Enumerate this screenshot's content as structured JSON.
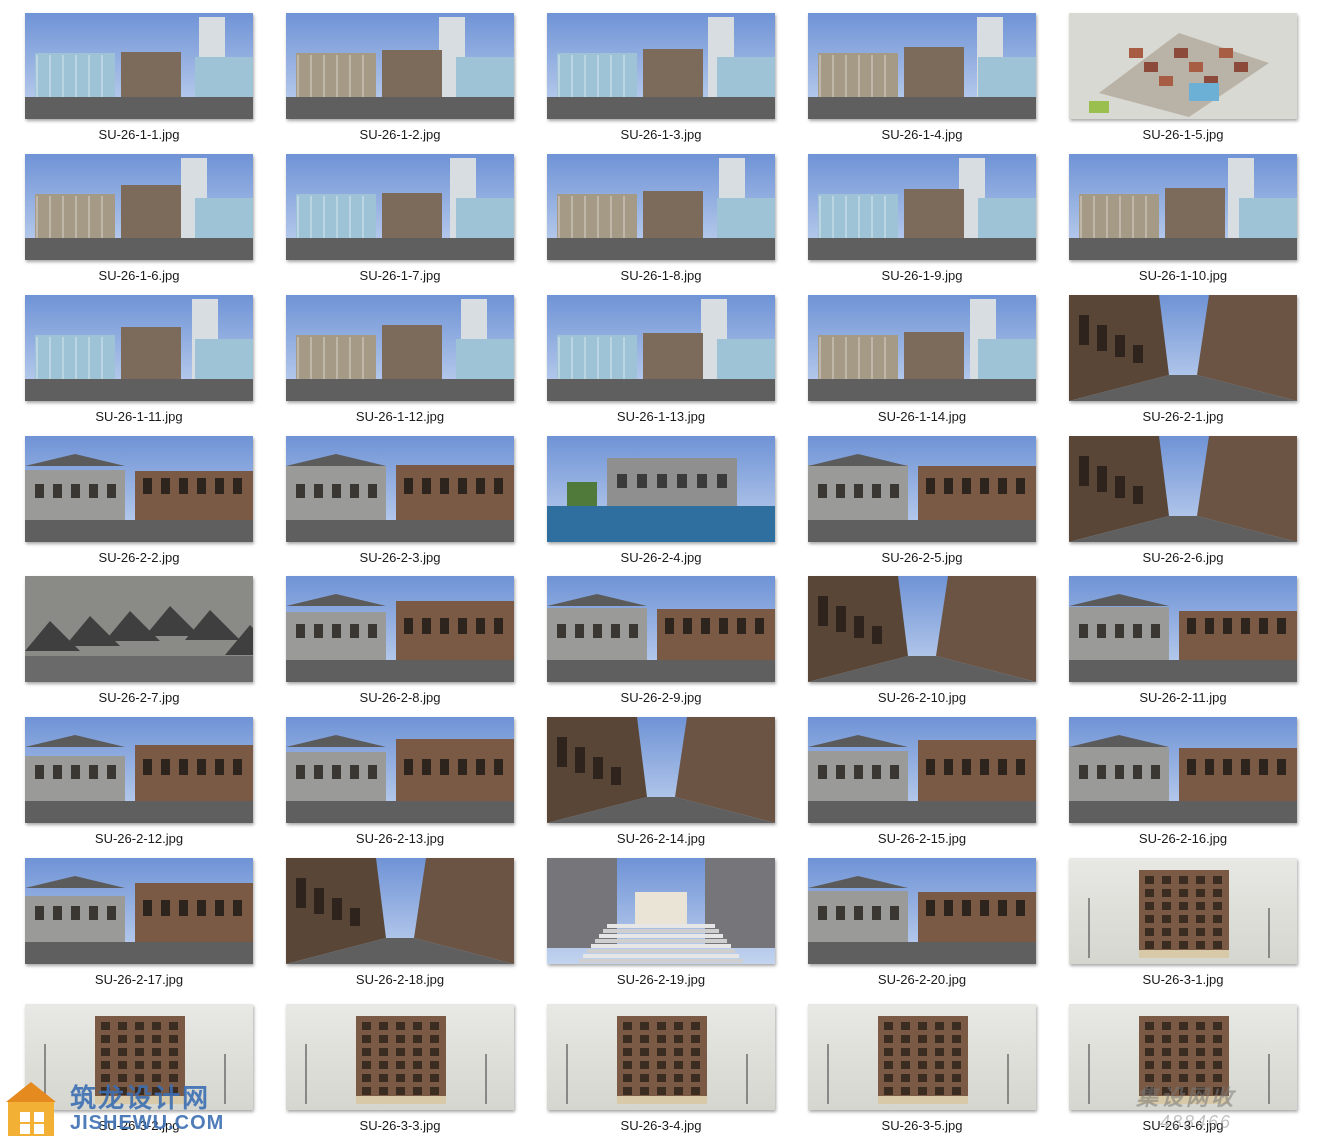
{
  "images": [
    {
      "name": "SU-26-1-1.jpg",
      "style": "modern"
    },
    {
      "name": "SU-26-1-2.jpg",
      "style": "modern"
    },
    {
      "name": "SU-26-1-3.jpg",
      "style": "modern"
    },
    {
      "name": "SU-26-1-4.jpg",
      "style": "modern"
    },
    {
      "name": "SU-26-1-5.jpg",
      "style": "aerial"
    },
    {
      "name": "SU-26-1-6.jpg",
      "style": "modern"
    },
    {
      "name": "SU-26-1-7.jpg",
      "style": "modern"
    },
    {
      "name": "SU-26-1-8.jpg",
      "style": "modern"
    },
    {
      "name": "SU-26-1-9.jpg",
      "style": "modern"
    },
    {
      "name": "SU-26-1-10.jpg",
      "style": "modern"
    },
    {
      "name": "SU-26-1-11.jpg",
      "style": "modern"
    },
    {
      "name": "SU-26-1-12.jpg",
      "style": "modern"
    },
    {
      "name": "SU-26-1-13.jpg",
      "style": "modern"
    },
    {
      "name": "SU-26-1-14.jpg",
      "style": "modern"
    },
    {
      "name": "SU-26-2-1.jpg",
      "style": "street"
    },
    {
      "name": "SU-26-2-2.jpg",
      "style": "classic"
    },
    {
      "name": "SU-26-2-3.jpg",
      "style": "classic"
    },
    {
      "name": "SU-26-2-4.jpg",
      "style": "water"
    },
    {
      "name": "SU-26-2-5.jpg",
      "style": "classic"
    },
    {
      "name": "SU-26-2-6.jpg",
      "style": "street"
    },
    {
      "name": "SU-26-2-7.jpg",
      "style": "roofs"
    },
    {
      "name": "SU-26-2-8.jpg",
      "style": "classic"
    },
    {
      "name": "SU-26-2-9.jpg",
      "style": "classic"
    },
    {
      "name": "SU-26-2-10.jpg",
      "style": "street"
    },
    {
      "name": "SU-26-2-11.jpg",
      "style": "classic"
    },
    {
      "name": "SU-26-2-12.jpg",
      "style": "classic"
    },
    {
      "name": "SU-26-2-13.jpg",
      "style": "classic"
    },
    {
      "name": "SU-26-2-14.jpg",
      "style": "street"
    },
    {
      "name": "SU-26-2-15.jpg",
      "style": "classic"
    },
    {
      "name": "SU-26-2-16.jpg",
      "style": "classic"
    },
    {
      "name": "SU-26-2-17.jpg",
      "style": "classic"
    },
    {
      "name": "SU-26-2-18.jpg",
      "style": "street"
    },
    {
      "name": "SU-26-2-19.jpg",
      "style": "stairs"
    },
    {
      "name": "SU-26-2-20.jpg",
      "style": "classic"
    },
    {
      "name": "SU-26-3-1.jpg",
      "style": "tower"
    },
    {
      "name": "SU-26-3-2.jpg",
      "style": "tower"
    },
    {
      "name": "SU-26-3-3.jpg",
      "style": "tower"
    },
    {
      "name": "SU-26-3-4.jpg",
      "style": "tower"
    },
    {
      "name": "SU-26-3-5.jpg",
      "style": "tower"
    },
    {
      "name": "SU-26-3-6.jpg",
      "style": "tower"
    }
  ],
  "watermark": {
    "site_name": "筑龙设计网",
    "url": "JISHEWU.COM",
    "stamp": "集设网收",
    "number": "488466"
  },
  "colors": {
    "sky_top": "#6f93d6",
    "sky_bottom": "#c3d4ef",
    "ground": "#5f5f5f",
    "brick": "#7a5a44",
    "glass": "#9fc3d6",
    "watermark_blue": "#3c6fb3"
  }
}
